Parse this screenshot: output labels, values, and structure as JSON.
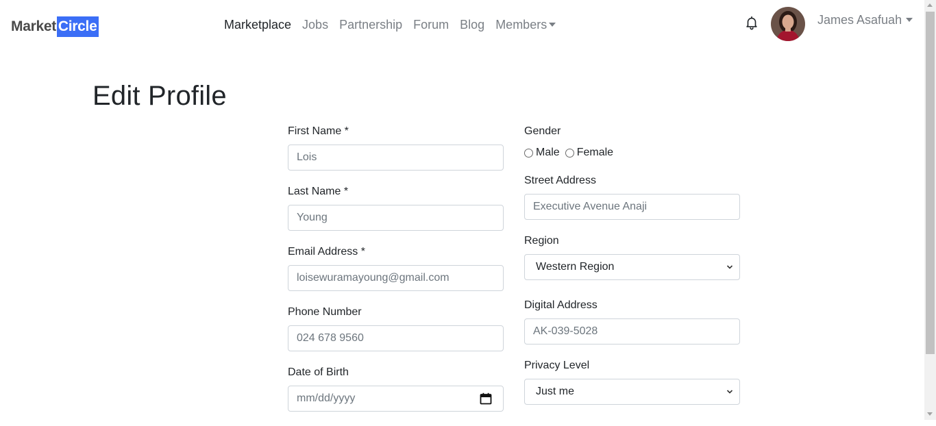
{
  "brand": {
    "part1": "Market",
    "part2": "Circle",
    "accent": "#3b6ef6"
  },
  "nav": {
    "items": [
      {
        "label": "Marketplace",
        "active": true
      },
      {
        "label": "Jobs"
      },
      {
        "label": "Partnership"
      },
      {
        "label": "Forum"
      },
      {
        "label": "Blog"
      },
      {
        "label": "Members",
        "dropdown": true
      }
    ],
    "notification_icon": "bell-icon",
    "user_name": "James Asafuah"
  },
  "page": {
    "title": "Edit Profile"
  },
  "form": {
    "first_name": {
      "label": "First Name *",
      "value": "Lois"
    },
    "last_name": {
      "label": "Last Name *",
      "value": "Young"
    },
    "email": {
      "label": "Email Address *",
      "value": "loisewuramayoung@gmail.com"
    },
    "phone": {
      "label": "Phone Number",
      "value": "024 678 9560"
    },
    "dob": {
      "label": "Date of Birth",
      "placeholder": "mm/dd/yyyy"
    },
    "gender": {
      "label": "Gender",
      "options": [
        "Male",
        "Female"
      ]
    },
    "street": {
      "label": "Street Address",
      "value": "Executive Avenue Anaji"
    },
    "region": {
      "label": "Region",
      "selected": "Western Region"
    },
    "digital": {
      "label": "Digital Address",
      "value": "AK-039-5028"
    },
    "privacy": {
      "label": "Privacy Level",
      "selected": "Just me"
    }
  }
}
